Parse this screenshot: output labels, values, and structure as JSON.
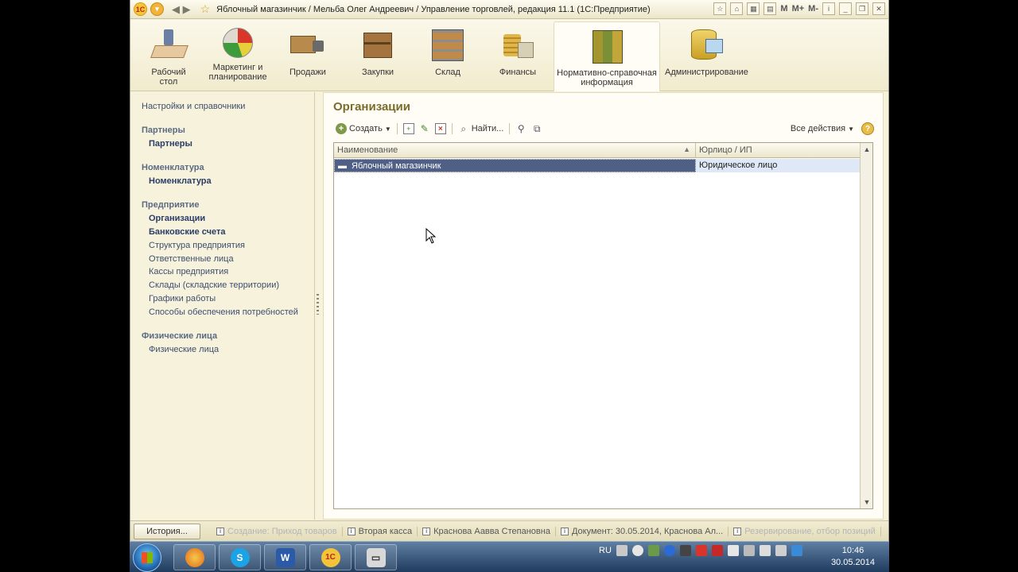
{
  "window": {
    "title": "Яблочный магазинчик / Мельба Олег Андреевич / Управление торговлей, редакция 11.1  (1С:Предприятие)",
    "logo_text": "1С",
    "m_buttons": [
      "M",
      "M+",
      "M-"
    ]
  },
  "sections": [
    {
      "label": "Рабочий\nстол",
      "icon": "desk-icon"
    },
    {
      "label": "Маркетинг и\nпланирование",
      "icon": "pie-chart-icon"
    },
    {
      "label": "Продажи",
      "icon": "truck-icon"
    },
    {
      "label": "Закупки",
      "icon": "box-icon"
    },
    {
      "label": "Склад",
      "icon": "warehouse-shelf-icon"
    },
    {
      "label": "Финансы",
      "icon": "coins-icon"
    },
    {
      "label": "Нормативно-справочная\nинформация",
      "icon": "books-icon",
      "active": true
    },
    {
      "label": "Администрирование",
      "icon": "database-icon"
    }
  ],
  "leftnav": {
    "top_link": "Настройки и справочники",
    "groups": [
      {
        "title": "Партнеры",
        "items": [
          "Партнеры"
        ]
      },
      {
        "title": "Номенклатура",
        "items": [
          "Номенклатура"
        ]
      },
      {
        "title": "Предприятие",
        "items": [
          "Организации",
          "Банковские счета",
          "Структура предприятия",
          "Ответственные лица",
          "Кассы предприятия",
          "Склады (складские территории)",
          "Графики работы",
          "Способы обеспечения потребностей"
        ]
      },
      {
        "title": "Физические лица",
        "items": [
          "Физические лица"
        ]
      }
    ]
  },
  "form": {
    "title": "Организации",
    "toolbar": {
      "create": "Создать",
      "find": "Найти...",
      "all_actions": "Все действия",
      "help": "?"
    },
    "table": {
      "columns": [
        "Наименование",
        "Юрлицо / ИП"
      ],
      "rows": [
        {
          "name": "Яблочный магазинчик",
          "type": "Юридическое лицо",
          "selected": true
        }
      ]
    }
  },
  "history": {
    "button": "История...",
    "items": [
      {
        "text": "Создание: Приход товаров",
        "faded": true
      },
      {
        "text": "Вторая касса",
        "faded": false
      },
      {
        "text": "Краснова Аавва Степановна",
        "faded": false
      },
      {
        "text": "Документ: 30.05.2014, Краснова Ал...",
        "faded": false
      },
      {
        "text": "Резервирование, отбор позиций",
        "faded": true
      }
    ]
  },
  "taskbar": {
    "apps": [
      "firefox-icon",
      "skype-icon",
      "word-icon",
      "1c-icon",
      "screen-recorder-icon"
    ],
    "language": "RU",
    "time": "10:46",
    "date": "30.05.2014"
  }
}
